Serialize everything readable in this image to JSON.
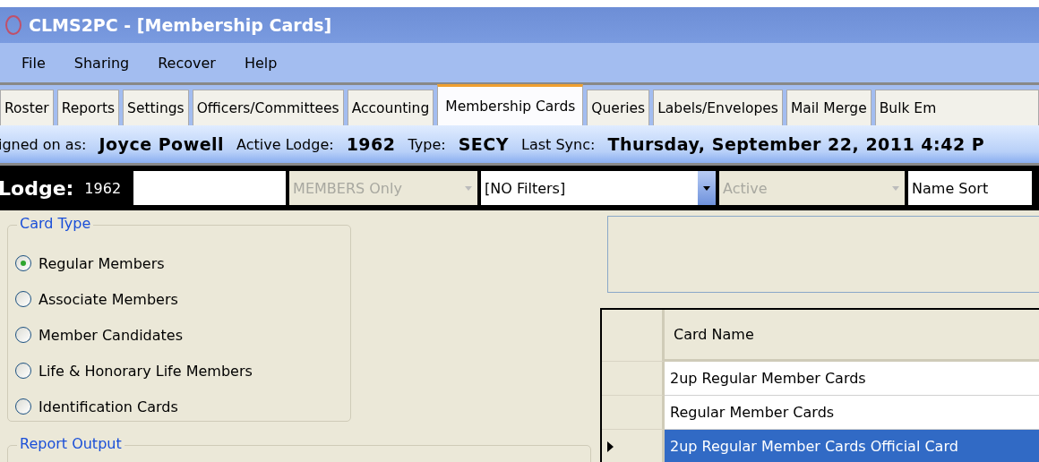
{
  "window": {
    "title": "CLMS2PC - [Membership Cards]"
  },
  "menu": [
    "File",
    "Sharing",
    "Recover",
    "Help"
  ],
  "tabs": [
    {
      "label": "Roster",
      "selected": false
    },
    {
      "label": "Reports",
      "selected": false
    },
    {
      "label": "Settings",
      "selected": false
    },
    {
      "label": "Officers/Committees",
      "selected": false
    },
    {
      "label": "Accounting",
      "selected": false
    },
    {
      "label": "Membership Cards",
      "selected": true
    },
    {
      "label": "Queries",
      "selected": false
    },
    {
      "label": "Labels/Envelopes",
      "selected": false
    },
    {
      "label": "Mail Merge",
      "selected": false
    },
    {
      "label": "Bulk Em",
      "selected": false
    }
  ],
  "info_bar": [
    {
      "label": "igned on as:",
      "value": "Joyce Powell"
    },
    {
      "label": "Active Lodge:",
      "value": "1962"
    },
    {
      "label": "Type:",
      "value": "SECY"
    },
    {
      "label": "Last Sync:",
      "value": "Thursday, September 22, 2011 4:42 P"
    }
  ],
  "lodge_bar": {
    "label": "Lodge:",
    "number": "1962",
    "fields": [
      {
        "kind": "text",
        "disabled": false
      },
      {
        "kind": "combo",
        "value": "MEMBERS Only",
        "disabled": true
      },
      {
        "kind": "combo",
        "value": "[NO Filters]",
        "disabled": false
      },
      {
        "kind": "combo",
        "value": "Active",
        "disabled": true
      },
      {
        "kind": "text",
        "value": "Name Sort",
        "disabled": false
      }
    ]
  },
  "card_type": {
    "title": "Card Type",
    "options": [
      {
        "label": "Regular Members",
        "selected": true
      },
      {
        "label": "Associate Members",
        "selected": false
      },
      {
        "label": "Member Candidates",
        "selected": false
      },
      {
        "label": "Life & Honorary Life Members",
        "selected": false
      },
      {
        "label": "Identification Cards",
        "selected": false
      }
    ]
  },
  "report_output": {
    "title": "Report Output"
  },
  "grid": {
    "columns": [
      "Card Name"
    ],
    "rows": [
      {
        "name": "2up Regular Member Cards",
        "selected": false
      },
      {
        "name": "Regular Member Cards",
        "selected": false
      },
      {
        "name": "2up Regular Member Cards Official Card",
        "selected": true
      }
    ]
  }
}
